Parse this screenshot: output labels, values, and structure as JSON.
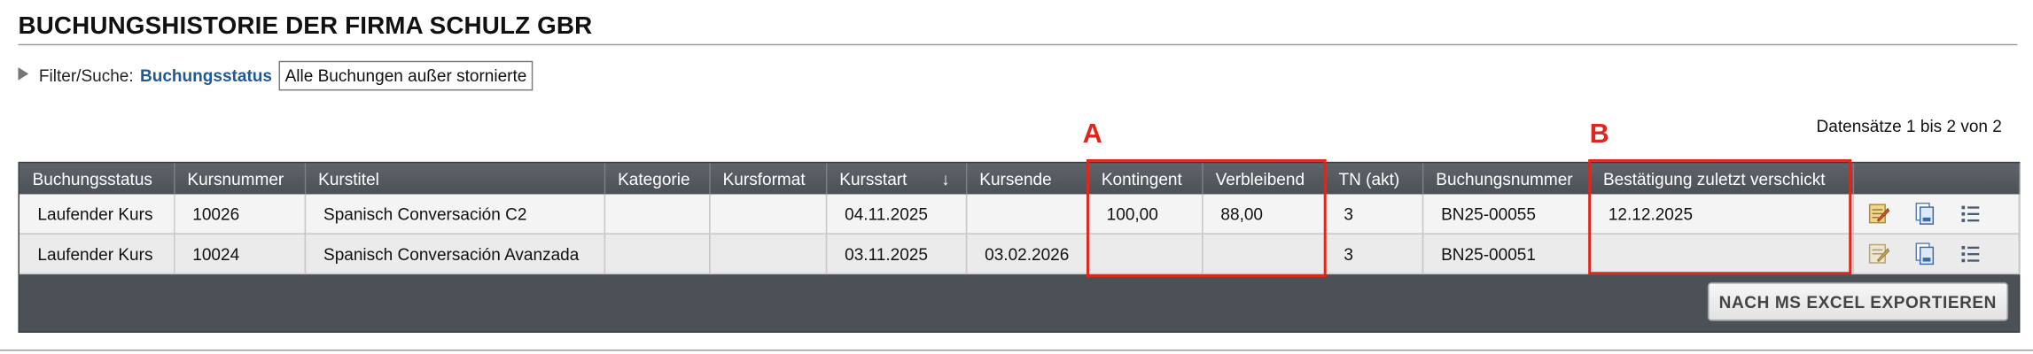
{
  "page": {
    "title": "BUCHUNGSHISTORIE DER FIRMA SCHULZ GBR"
  },
  "filter": {
    "label": "Filter/Suche:",
    "status_link": "Buchungsstatus",
    "selected_value": "Alle Buchungen außer stornierte"
  },
  "records": {
    "summary": "Datensätze 1 bis 2 von 2"
  },
  "annotations": {
    "a": "A",
    "b": "B",
    "color": "#e1251b"
  },
  "table": {
    "columns": [
      "Buchungsstatus",
      "Kursnummer",
      "Kurstitel",
      "Kategorie",
      "Kursformat",
      "Kursstart",
      "Kursende",
      "Kontingent",
      "Verbleibend",
      "TN (akt)",
      "Buchungsnummer",
      "Bestätigung zuletzt verschickt",
      ""
    ],
    "sort_indicator": "↓",
    "rows": [
      {
        "status": "Laufender Kurs",
        "kursnummer": "10026",
        "kurstitel": "Spanisch Conversación C2",
        "kategorie": "",
        "kursformat": "",
        "kursstart": "04.11.2025",
        "kursende": "",
        "kontingent": "100,00",
        "verbleibend": "88,00",
        "tn": "3",
        "buchungsnummer": "BN25-00055",
        "bestaetigung": "12.12.2025"
      },
      {
        "status": "Laufender Kurs",
        "kursnummer": "10024",
        "kurstitel": "Spanisch Conversación Avanzada",
        "kategorie": "",
        "kursformat": "",
        "kursstart": "03.11.2025",
        "kursende": "03.02.2026",
        "kontingent": "",
        "verbleibend": "",
        "tn": "3",
        "buchungsnummer": "BN25-00051",
        "bestaetigung": ""
      }
    ],
    "row_actions": [
      "edit-note-icon",
      "document-copy-icon",
      "list-icon"
    ]
  },
  "export": {
    "label": "NACH MS EXCEL EXPORTIEREN"
  },
  "colors": {
    "header_bg": "#4c5157",
    "link": "#1f5a96",
    "row_bg": "#f4f4f4"
  }
}
